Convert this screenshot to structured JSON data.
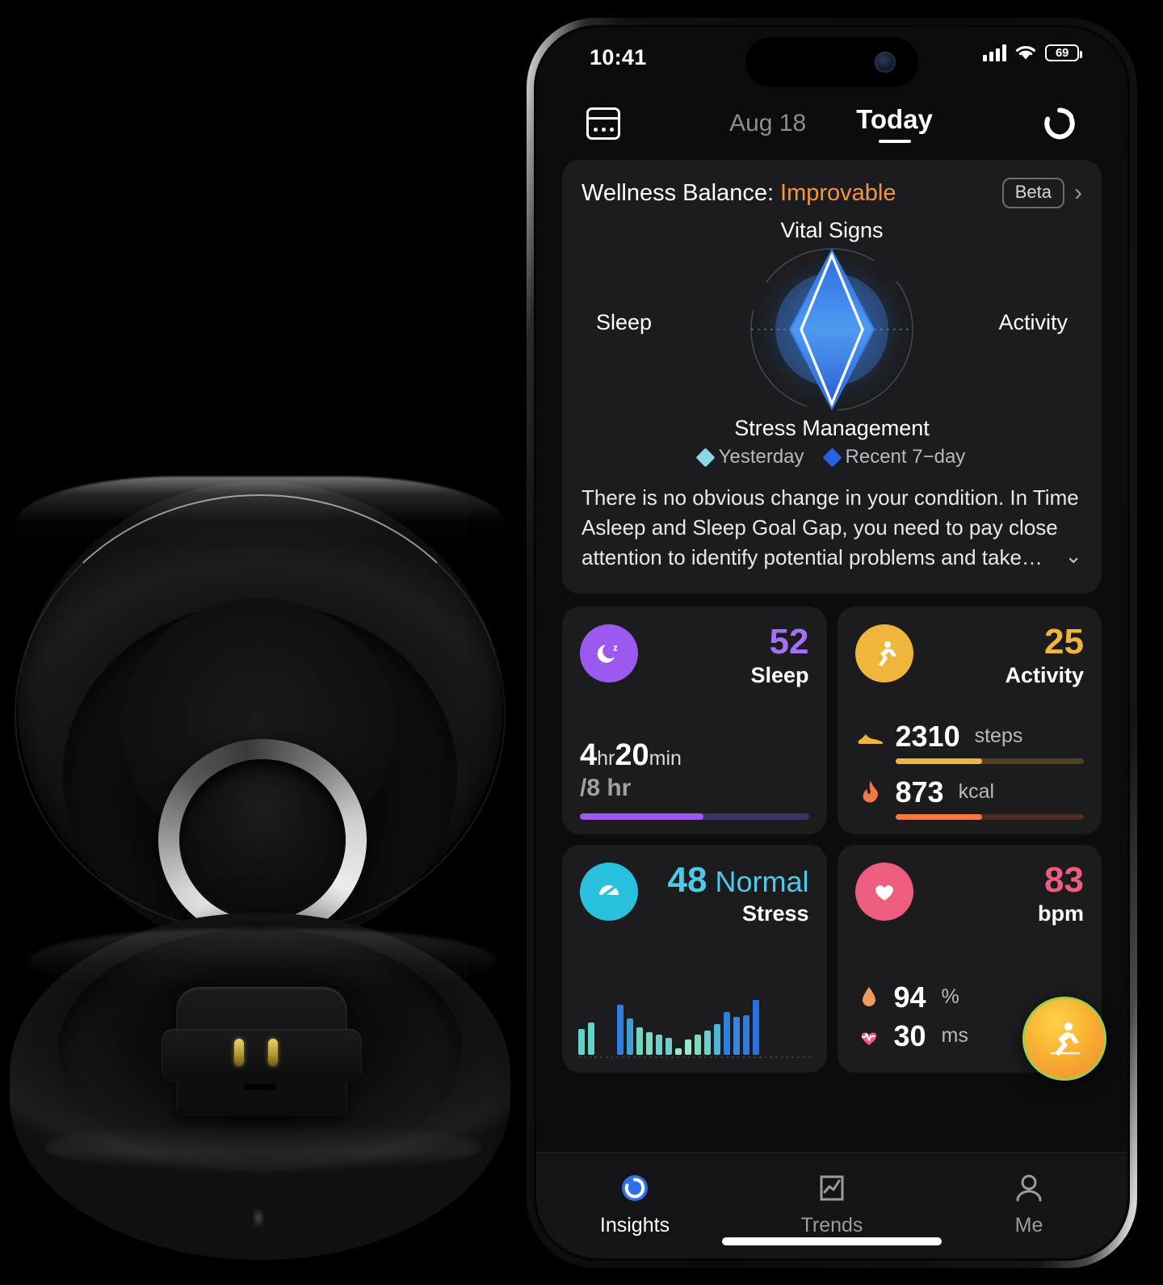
{
  "status_bar": {
    "time": "10:41",
    "signal_icon": "cellular-signal-icon",
    "wifi_icon": "wifi-icon",
    "battery_level": "69"
  },
  "navbar": {
    "calendar_icon": "calendar-icon",
    "date": "Aug 18",
    "today_tab": "Today",
    "refresh_icon": "ring-logo-refresh-icon"
  },
  "wellness": {
    "title": "Wellness Balance:",
    "status": "Improvable",
    "status_color": "#f0963c",
    "beta_badge": "Beta",
    "chevron_right": "›",
    "axes": {
      "top": "Vital Signs",
      "left": "Sleep",
      "right": "Activity",
      "bottom": "Stress Management"
    },
    "legend": [
      {
        "label": "Yesterday",
        "color": "#8fd6e8"
      },
      {
        "label": "Recent 7−day",
        "color": "#2a5fe8"
      }
    ],
    "description": "There is no obvious change in your condition. In Time Asleep and Sleep Goal Gap, you need to pay close attention to identify potential problems and take…",
    "chevron_down": "⌄"
  },
  "chart_data": {
    "type": "radar",
    "title": "Wellness Balance",
    "categories": [
      "Vital Signs",
      "Activity",
      "Stress Management",
      "Sleep"
    ],
    "range": [
      0,
      100
    ],
    "grid": true,
    "legend_position": "bottom",
    "series": [
      {
        "name": "Yesterday",
        "color": "#8fd6e8",
        "values": [
          96,
          38,
          96,
          38
        ]
      },
      {
        "name": "Recent 7−day",
        "color": "#2a5fe8",
        "values": [
          88,
          46,
          88,
          46
        ]
      }
    ]
  },
  "metrics": {
    "sleep": {
      "icon": "moon-sleep-icon",
      "icon_bg": "#9b59f0",
      "score": "52",
      "score_color": "#a670f5",
      "label": "Sleep",
      "duration_hours": "4",
      "hours_unit": "hr",
      "duration_minutes": "20",
      "minutes_unit": "min",
      "goal": "/8 hr",
      "progress_percent": 54
    },
    "activity": {
      "icon": "running-person-icon",
      "icon_bg": "#f0b63c",
      "score": "25",
      "score_color": "#f0b63c",
      "label": "Activity",
      "rows": [
        {
          "icon": "shoe-icon",
          "glyph": "👟",
          "value": "2310",
          "unit": "steps",
          "progress_percent": 46,
          "color": "#f0b63c"
        },
        {
          "icon": "flame-icon",
          "glyph": "🔥",
          "value": "873",
          "unit": "kcal",
          "progress_percent": 46,
          "color": "#f07a42"
        }
      ]
    },
    "stress": {
      "icon": "gauge-stress-icon",
      "icon_bg": "#29c0dd",
      "score": "48",
      "score_color": "#4ec9e8",
      "status": "Normal",
      "label": "Stress",
      "chart": {
        "type": "bar",
        "values": [
          34,
          42,
          0,
          0,
          66,
          48,
          36,
          30,
          26,
          22,
          8,
          20,
          26,
          32,
          40,
          56,
          50,
          52,
          72
        ],
        "colors": [
          "#5fd3c8",
          "#5fd3c8",
          "#000000",
          "#000000",
          "#2f7fe0",
          "#3f9fd8",
          "#6fd6c0",
          "#7fd9bd",
          "#6fcfc9",
          "#6fcfc9",
          "#9be6c8",
          "#9be6c8",
          "#7fd9bd",
          "#6fcfc9",
          "#4fb6d6",
          "#2f7fe0",
          "#3a86dd",
          "#3278df",
          "#2a6fe2"
        ],
        "tick_count": 43
      }
    },
    "heart": {
      "icon": "heart-icon",
      "icon_bg": "#ef5d7e",
      "score": "83",
      "score_color": "#ef5d7e",
      "label": "bpm",
      "rows": [
        {
          "icon": "blood-oxygen-drop-icon",
          "value": "94",
          "unit": "%"
        },
        {
          "icon": "hrv-heartbeat-icon",
          "value": "30",
          "unit": "ms"
        }
      ],
      "fab_icon": "workout-running-icon"
    }
  },
  "tabbar": {
    "items": [
      {
        "label": "Insights",
        "icon": "ring-insights-icon",
        "active": true
      },
      {
        "label": "Trends",
        "icon": "trends-chart-icon",
        "active": false
      },
      {
        "label": "Me",
        "icon": "person-profile-icon",
        "active": false
      }
    ]
  }
}
